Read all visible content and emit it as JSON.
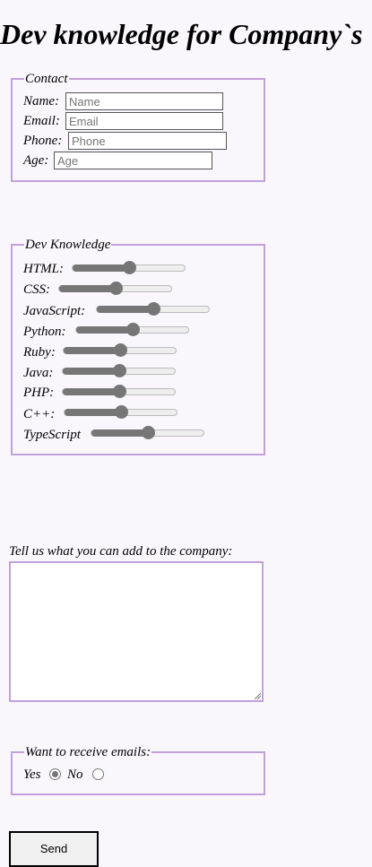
{
  "page": {
    "title": "Dev knowledge for Company`s"
  },
  "contact": {
    "legend": "Contact",
    "fields": [
      {
        "label": "Name:",
        "placeholder": "Name"
      },
      {
        "label": "Email:",
        "placeholder": "Email"
      },
      {
        "label": "Phone:",
        "placeholder": "Phone"
      },
      {
        "label": "Age:",
        "placeholder": "Age"
      }
    ]
  },
  "dev": {
    "legend": "Dev Knowledge",
    "skills": [
      {
        "label": "HTML:",
        "value": 50
      },
      {
        "label": "CSS:",
        "value": 50
      },
      {
        "label": "JavaScript:",
        "value": 50
      },
      {
        "label": "Python:",
        "value": 50
      },
      {
        "label": "Ruby:",
        "value": 50
      },
      {
        "label": "Java:",
        "value": 50
      },
      {
        "label": "PHP:",
        "value": 50
      },
      {
        "label": "C++:",
        "value": 50
      },
      {
        "label": "TypeScript",
        "value": 50
      }
    ]
  },
  "about": {
    "label": "Tell us what you can add to the company:",
    "value": ""
  },
  "emails": {
    "legend": "Want to receive emails:",
    "yes_label": "Yes",
    "no_label": "No",
    "selected": "Yes"
  },
  "send_label": "Send"
}
